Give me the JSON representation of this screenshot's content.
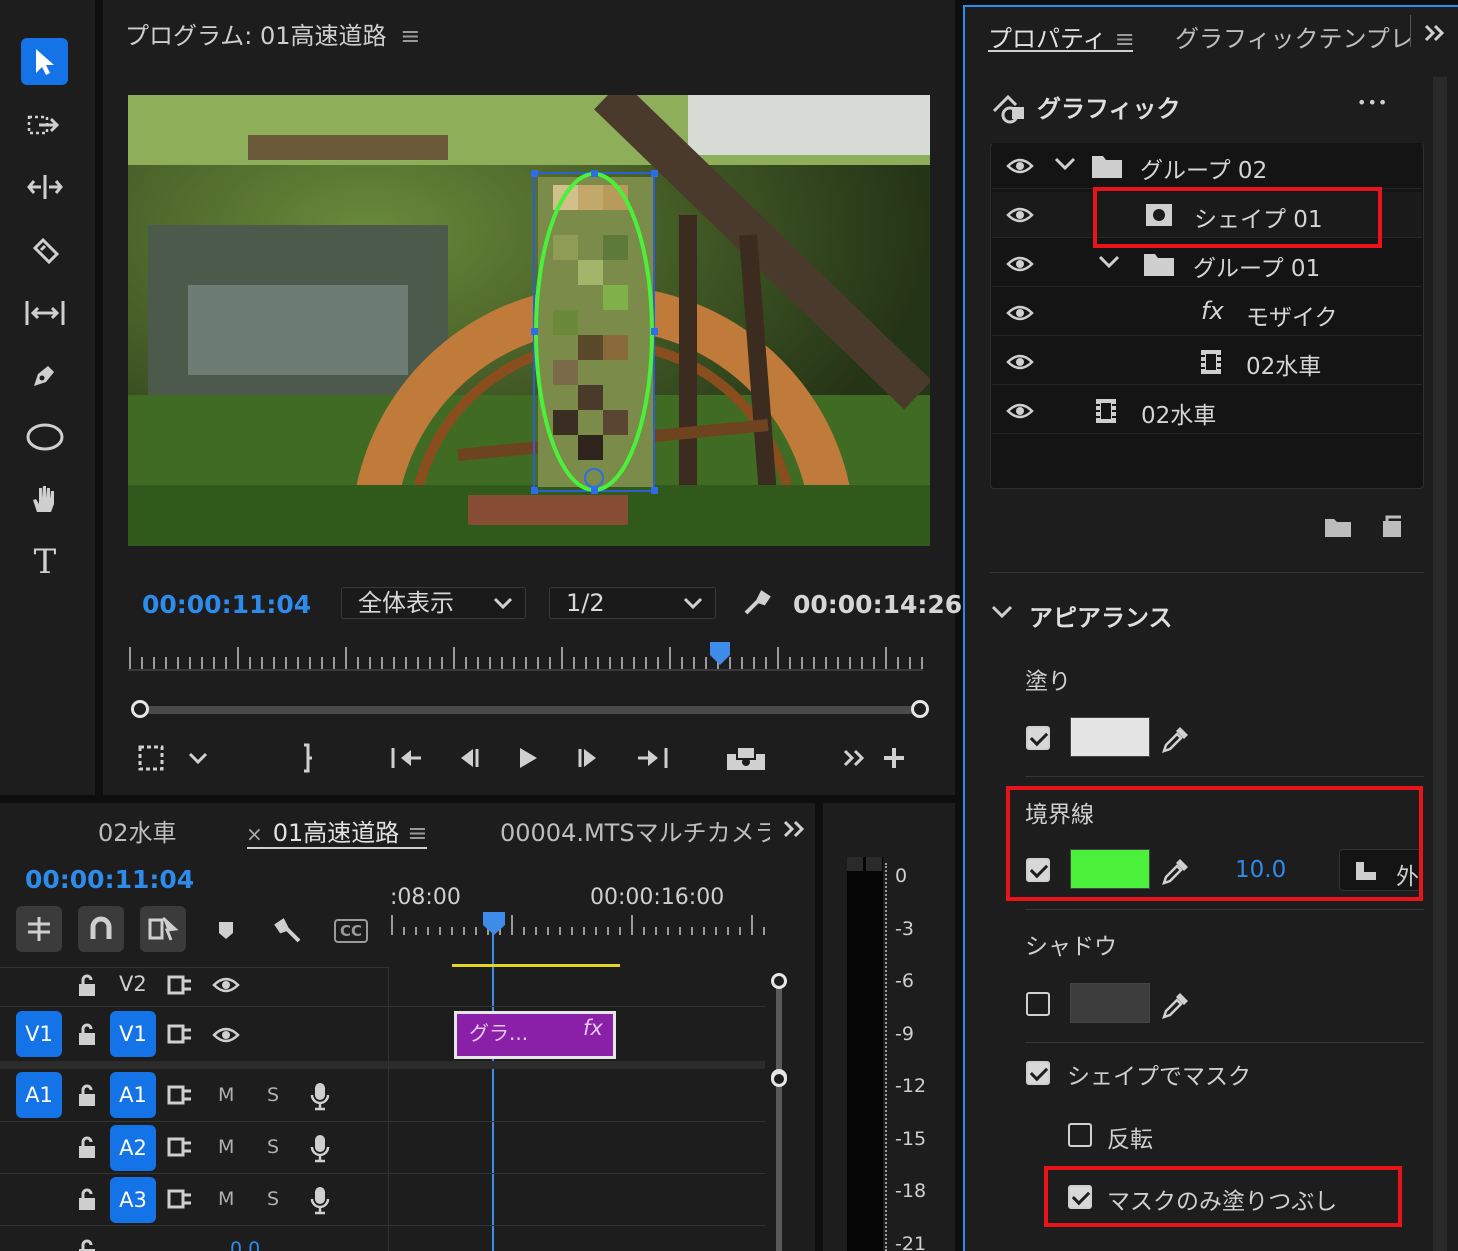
{
  "toolbar": {
    "tools": [
      "selection-tool",
      "track-select-tool",
      "ripple-edit-tool",
      "razor-tool",
      "slip-tool",
      "pen-tool",
      "ellipse-tool",
      "hand-tool",
      "type-tool"
    ],
    "type_label": "T"
  },
  "program": {
    "title": "プログラム: 01高速道路",
    "timecode": "00:00:11:04",
    "zoom": "全体表示",
    "resolution": "1/2",
    "duration": "00:00:14:26",
    "playhead_fraction": 0.74
  },
  "timeline": {
    "tabs": [
      "02水車",
      "01高速道路",
      "00004.MTSマルチカメラ"
    ],
    "close_mark": "×",
    "timecode": "00:00:11:04",
    "ruler": [
      ":08:00",
      "00:00:16:00"
    ],
    "cc_label": "CC",
    "tracks": {
      "v2": "V2",
      "v1_src": "V1",
      "v1": "V1",
      "a1_src": "A1",
      "a1": "A1",
      "a2": "A2",
      "a3": "A3",
      "m": "M",
      "s": "S",
      "mix_value": "0.0"
    },
    "clip_label": "グラ...",
    "clip_fx": "fx"
  },
  "meter": {
    "scale": [
      "0",
      "-3",
      "-6",
      "-9",
      "-12",
      "-15",
      "-18",
      "-21"
    ]
  },
  "properties": {
    "tab_active": "プロパティ",
    "tab_other": "グラフィックテンプレ",
    "section_graphic": "グラフィック",
    "more": "•••",
    "layers": [
      {
        "label": "グループ 02"
      },
      {
        "label": "シェイプ 01"
      },
      {
        "label": "グループ 01"
      },
      {
        "label": "モザイク",
        "fx": "fx"
      },
      {
        "label": "02水車"
      },
      {
        "label": "02水車"
      }
    ],
    "appearance": "アピアランス",
    "fill": {
      "label": "塗り",
      "checked": true,
      "color": "#e5e5e5"
    },
    "stroke": {
      "label": "境界線",
      "checked": true,
      "color": "#4bf03a",
      "width": "10.0",
      "position": "外"
    },
    "shadow": {
      "label": "シャドウ",
      "checked": false,
      "color": "#3d3d3d"
    },
    "mask_with_shape": {
      "label": "シェイプでマスク",
      "checked": true
    },
    "invert": {
      "label": "反転",
      "checked": false
    },
    "mask_fill_only": {
      "label": "マスクのみ塗りつぶし",
      "checked": true
    }
  },
  "colors": {
    "accent": "#1473e6",
    "timecode_blue": "#2d8ceb",
    "highlight_red": "#e8141a",
    "clip_purple": "#8a1fa8"
  }
}
